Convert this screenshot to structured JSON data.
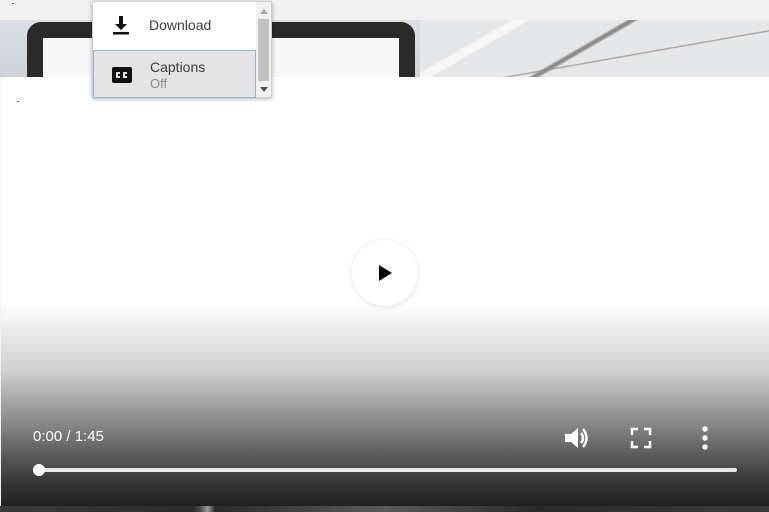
{
  "player": {
    "time_display": "0:00 / 1:45",
    "progress": 0
  },
  "menu": {
    "download_label": "Download",
    "captions_label": "Captions",
    "captions_value": "Off"
  },
  "icons": {
    "play": "play-icon",
    "volume": "volume-icon",
    "fullscreen": "fullscreen-icon",
    "more": "more-vert-icon",
    "download": "download-icon",
    "captions": "closed-captions-icon"
  },
  "colors": {
    "menu_selected_bg": "#e4e4e4",
    "menu_selected_border": "#8fb6dd",
    "control_icon": "#ffffff"
  }
}
